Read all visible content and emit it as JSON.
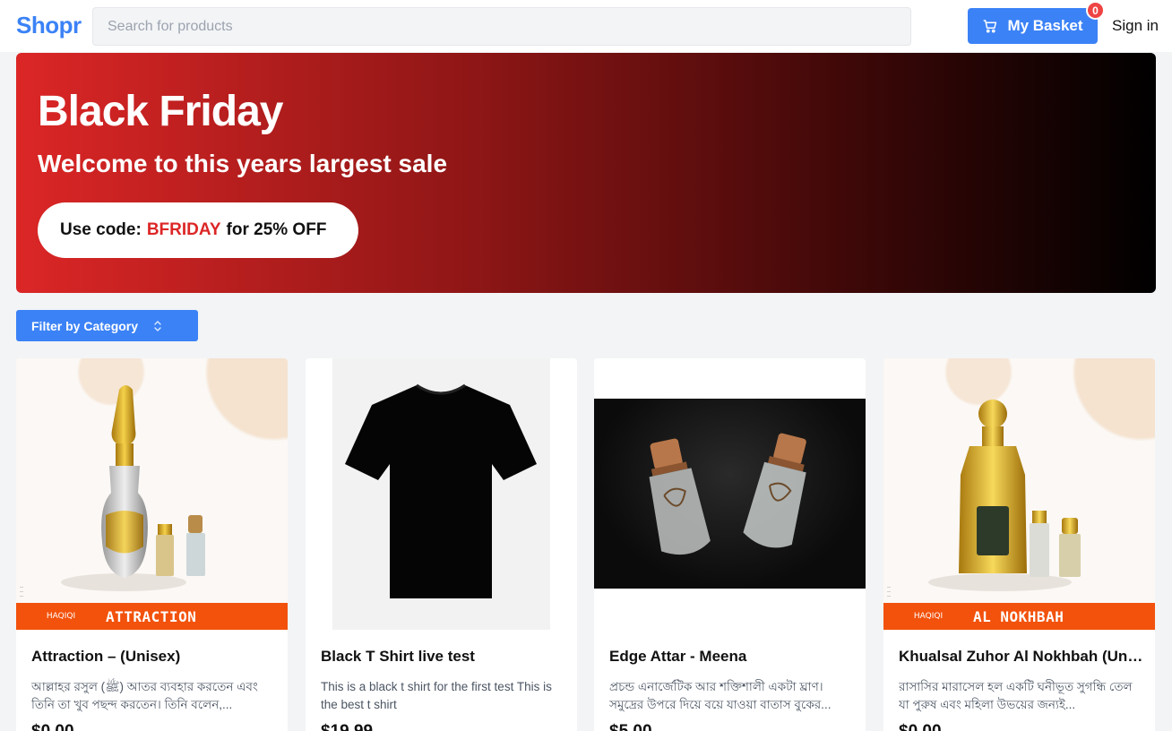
{
  "header": {
    "logo": "Shopr",
    "search_placeholder": "Search for products",
    "basket_label": "My Basket",
    "basket_count": "0",
    "signin_label": "Sign in"
  },
  "banner": {
    "title": "Black Friday",
    "subtitle": "Welcome to this years largest sale",
    "promo_prefix": "Use code:",
    "promo_code": "BFRIDAY",
    "promo_suffix": "for 25% OFF",
    "colors": {
      "start": "#dc2626",
      "end": "#000000",
      "code": "#dc2626"
    }
  },
  "filter": {
    "label": "Filter by Category",
    "icon": "chevron-up-down-icon"
  },
  "accent_color": "#3b82f6",
  "products": [
    {
      "name": "Attraction – (Unisex)",
      "description": "আল্লাহর রসুল (ﷺ) আতর ব্যবহার করতেন এবং তিনি তা খুব পছন্দ করতেন। তিনি বলেন,...",
      "price": "$0.00",
      "image_brand": "HAQIQI",
      "image_label": "ATTRACTION"
    },
    {
      "name": "Black T Shirt live test",
      "description": "This is a black t shirt for the first test This is the best t shirt",
      "price": "$19.99"
    },
    {
      "name": "Edge Attar - Meena",
      "description": "প্রচন্ড এনার্জেটিক আর শক্তিশালী একটা ঘ্রাণ। সমুদ্রের উপরে দিয়ে বয়ে যাওয়া বাতাস বুকের...",
      "price": "$5.00"
    },
    {
      "name": "Khualsal Zuhor Al Nokhbah (Unisex)",
      "description": "রাসাসির মারাসেল হল একটি ঘনীভূত সুগন্ধি তেল যা পুরুষ এবং মহিলা উভয়ের জন্যই...",
      "price": "$0.00",
      "image_brand": "HAQIQI",
      "image_label": "AL NOKHBAH"
    }
  ]
}
